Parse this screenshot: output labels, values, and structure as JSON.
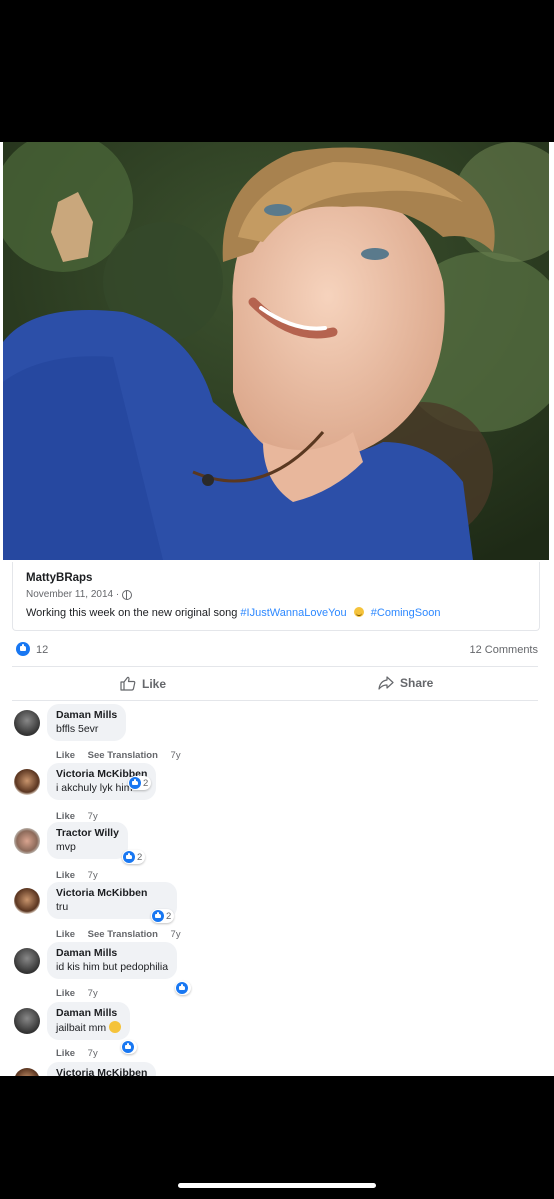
{
  "post": {
    "author": "MattyBRaps",
    "date": "November 11, 2014 ·",
    "caption_text": "Working this week on the new original song",
    "hashtag_1": "#IJustWannaLoveYou",
    "hashtag_2": "#ComingSoon",
    "reaction_count": "12",
    "comments_count": "12 Comments",
    "like_label": "Like",
    "share_label": "Share"
  },
  "comments": [
    {
      "name": "Daman Mills",
      "text": "bffls 5evr",
      "like": "Like",
      "see_translation": "See Translation",
      "time": "7y"
    },
    {
      "name": "Victoria McKibben",
      "text": "i akchuly lyk him",
      "like": "Like",
      "time": "7y",
      "reactions": "2"
    },
    {
      "name": "Tractor Willy",
      "text": "mvp",
      "like": "Like",
      "time": "7y",
      "reactions": "2"
    },
    {
      "name": "Victoria McKibben",
      "text": "tru",
      "like": "Like",
      "see_translation": "See Translation",
      "time": "7y",
      "reactions": "2"
    },
    {
      "name": "Daman Mills",
      "text": "id kis him but pedophilia",
      "like": "Like",
      "time": "7y"
    },
    {
      "name": "Daman Mills",
      "text": "jailbait mm",
      "like": "Like",
      "time": "7y"
    },
    {
      "name": "Victoria McKibben"
    }
  ],
  "colors": {
    "accent": "#1877f2",
    "hashtag": "#2d88ff",
    "bubble": "#f0f2f5",
    "text_secondary": "#65676b"
  },
  "icons": [
    "globe-icon",
    "like-reaction-icon",
    "thumbs-up-icon",
    "share-icon",
    "haha-reaction-icon",
    "smile-emoji-icon"
  ]
}
